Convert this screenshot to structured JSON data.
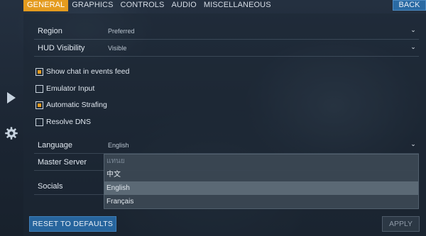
{
  "tabs": [
    {
      "label": "GENERAL",
      "active": true
    },
    {
      "label": "GRAPHICS",
      "active": false
    },
    {
      "label": "CONTROLS",
      "active": false
    },
    {
      "label": "AUDIO",
      "active": false
    },
    {
      "label": "MISCELLANEOUS",
      "active": false
    }
  ],
  "back_label": "BACK",
  "rail": {
    "play_icon": "play-icon",
    "settings_icon": "gear-icon"
  },
  "settings": {
    "region": {
      "label": "Region",
      "value": "Preferred"
    },
    "hud_visibility": {
      "label": "HUD Visibility",
      "value": "Visible"
    },
    "language": {
      "label": "Language",
      "value": "English"
    },
    "master_server": {
      "label": "Master Server"
    },
    "socials": {
      "label": "Socials"
    }
  },
  "checkboxes": [
    {
      "label": "Show chat in events feed",
      "checked": true
    },
    {
      "label": "Emulator Input",
      "checked": false
    },
    {
      "label": "Automatic Strafing",
      "checked": true
    },
    {
      "label": "Resolve DNS",
      "checked": false
    }
  ],
  "language_options": [
    {
      "label": "แทนย",
      "state": "dim"
    },
    {
      "label": "中文",
      "state": "normal"
    },
    {
      "label": "English",
      "state": "selected"
    },
    {
      "label": "Français",
      "state": "normal"
    }
  ],
  "buttons": {
    "reset": "RESET TO DEFAULTS",
    "apply": "APPLY"
  },
  "colors": {
    "accent": "#e49b1e",
    "primary_button": "#27659d"
  }
}
